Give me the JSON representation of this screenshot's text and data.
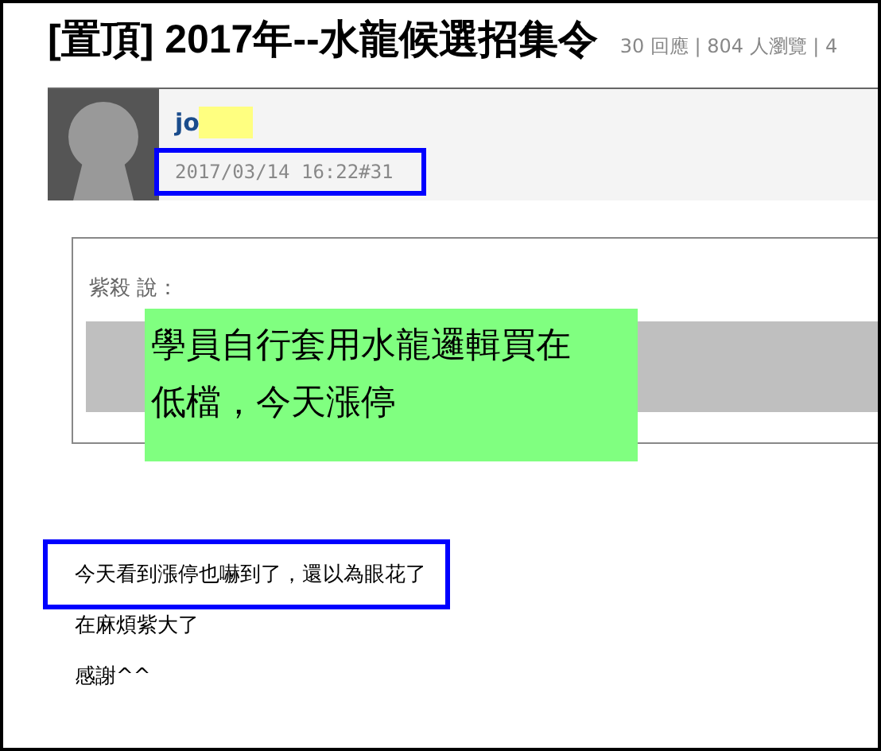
{
  "title": "[置頂] 2017年--水龍候選招集令",
  "stats": "30 回應 | 804 人瀏覽 | 4",
  "post": {
    "author": "jo",
    "author_redacted": true,
    "timestamp": "2017/03/14 16:22#31",
    "timestamp_highlighted": true,
    "quote": {
      "attribution": "紫殺 說："
    },
    "note_lines": [
      "學員自行套用水龍邏輯買在",
      "低檔，今天漲停"
    ],
    "lines": [
      {
        "text": "今天看到漲停也嚇到了，還以為眼花了",
        "highlighted": true
      },
      {
        "text": "在麻煩紫大了",
        "highlighted": false
      },
      {
        "text": "感謝^^",
        "highlighted": false
      }
    ]
  }
}
